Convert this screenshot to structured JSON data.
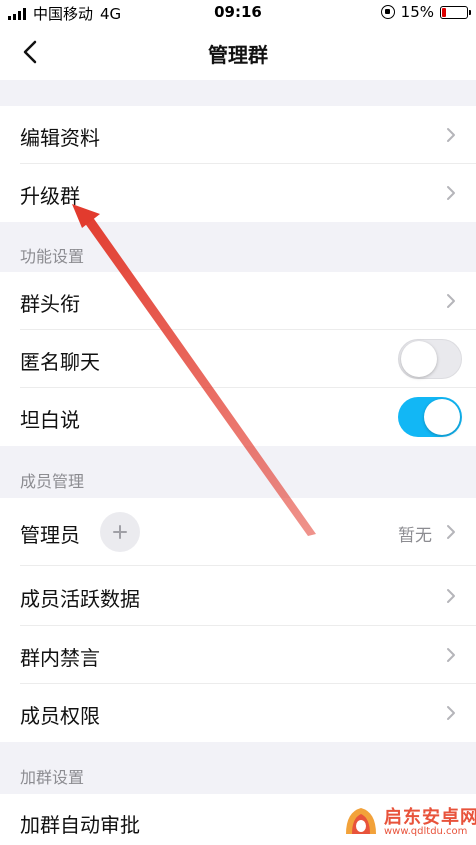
{
  "status_bar": {
    "carrier": "中国移动",
    "network": "4G",
    "time": "09:16",
    "battery": "15%",
    "battery_level": 0.15,
    "battery_color": "#dd0000"
  },
  "nav": {
    "back_icon": "chevron-left-icon",
    "title": "管理群"
  },
  "group_top": {
    "items": [
      {
        "label": "编辑资料",
        "chevron": true
      },
      {
        "label": "升级群",
        "chevron": true
      }
    ]
  },
  "features": {
    "header": "功能设置",
    "items": [
      {
        "label": "群头衔",
        "chevron": true
      },
      {
        "label": "匿名聊天",
        "toggle": false
      },
      {
        "label": "坦白说",
        "toggle": true
      }
    ]
  },
  "members": {
    "header": "成员管理",
    "admin": {
      "label": "管理员",
      "value": "暂无",
      "add_icon": "plus-icon"
    },
    "items": [
      {
        "label": "成员活跃数据",
        "chevron": true
      },
      {
        "label": "群内禁言",
        "chevron": true
      },
      {
        "label": "成员权限",
        "chevron": true
      }
    ]
  },
  "join": {
    "header": "加群设置",
    "items": [
      {
        "label": "加群自动审批"
      }
    ]
  },
  "colors": {
    "toggle_on": "#12b7f5",
    "annotation_arrow": "#e23b2e"
  },
  "watermark": {
    "name": "启东安卓网",
    "url": "www.qdltdu.com"
  }
}
